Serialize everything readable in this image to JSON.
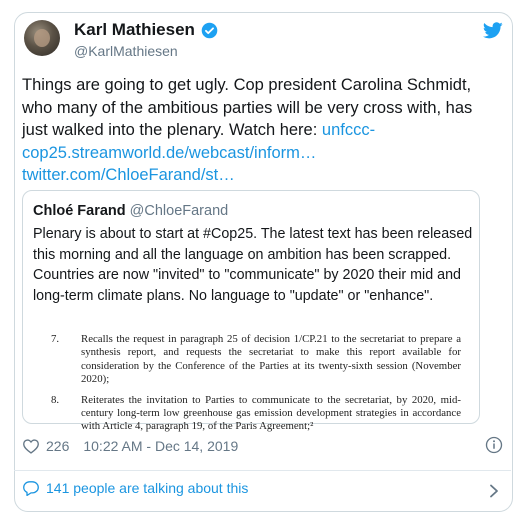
{
  "author": {
    "name": "Karl Mathiesen",
    "handle": "@KarlMathiesen"
  },
  "tweet": {
    "text_before_link": "Things are going to get ugly. Cop president Carolina Schmidt, who many of the ambitious parties will be very cross with, has just walked into the plenary. Watch here: ",
    "link1": "unfccc-cop25.streamworld.de/webcast/inform…",
    "link2": "twitter.com/ChloeFarand/st…"
  },
  "quoted": {
    "name": "Chloé Farand",
    "handle": "@ChloeFarand",
    "text": "Plenary is about to start at #Cop25. The latest text has been released this morning and all the language on ambition has been scrapped. Countries are now \"invited\" to \"communicate\" by 2020 their mid and long-term climate plans. No language to \"update\" or \"enhance\".",
    "document": [
      {
        "number": "7.",
        "text": "Recalls the request in paragraph 25 of decision 1/CP.21 to the secretariat to prepare a synthesis report, and requests the secretariat to make this report available for consideration by the Conference of the Parties at its twenty-sixth session (November 2020);"
      },
      {
        "number": "8.",
        "text": "Reiterates the invitation to Parties to communicate to the secretariat, by 2020, mid-century long-term low greenhouse gas emission development strategies in accordance with Article 4, paragraph 19, of the Paris Agreement;²"
      }
    ]
  },
  "meta": {
    "likes": "226",
    "timestamp": "10:22 AM - Dec 14, 2019"
  },
  "footer": {
    "talking": "141 people are talking about this"
  },
  "colors": {
    "twitter_blue": "#1da1f2",
    "link": "#1b95e0",
    "text": "#14171a",
    "muted": "#657786"
  }
}
